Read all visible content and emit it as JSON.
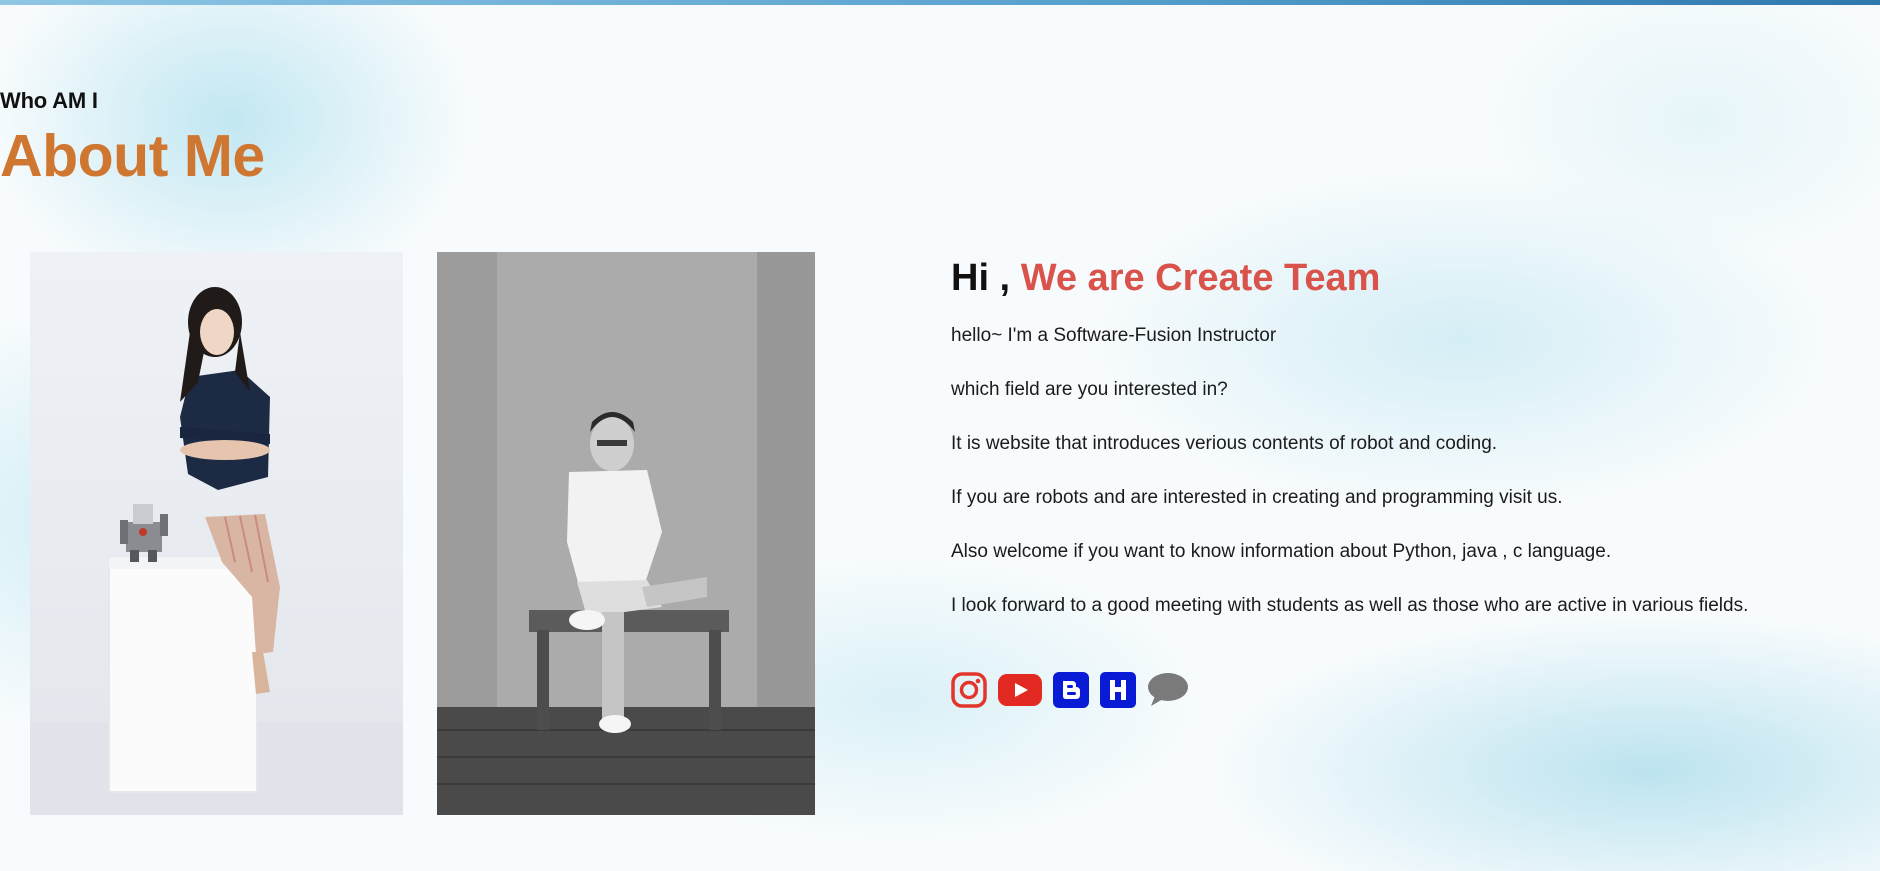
{
  "section": {
    "subtitle": "Who AM I",
    "title": "About Me"
  },
  "photos": [
    {
      "alt": "Woman in navy blouse and striped trousers sitting on a white cube beside a small robot"
    },
    {
      "alt": "Man in white t-shirt and shorts sitting on a bench, black and white photo"
    }
  ],
  "intro": {
    "greeting": "Hi ,",
    "team_name": "We are Create Team",
    "paragraphs": [
      "hello~ I'm a Software-Fusion Instructor",
      "which field are you interested in?",
      "It is website that introduces verious contents of robot and coding.",
      "If you are robots and are interested in creating and programming visit us.",
      "Also welcome if you want to know information about Python, java , c language.",
      "I look forward to a good meeting with students as well as those who are active in various fields."
    ]
  },
  "socials": [
    {
      "icon": "instagram-icon",
      "color": "#e4352d"
    },
    {
      "icon": "youtube-icon",
      "color": "#e32a22"
    },
    {
      "icon": "blogger-icon",
      "color": "#0a1bd6"
    },
    {
      "icon": "h-icon",
      "color": "#0a1bd6"
    },
    {
      "icon": "chat-bubble-icon",
      "color": "#7a7a7a"
    }
  ],
  "colors": {
    "title": "#cf7630",
    "team_name": "#d9534a",
    "top_bar": "#5aa2cf"
  }
}
